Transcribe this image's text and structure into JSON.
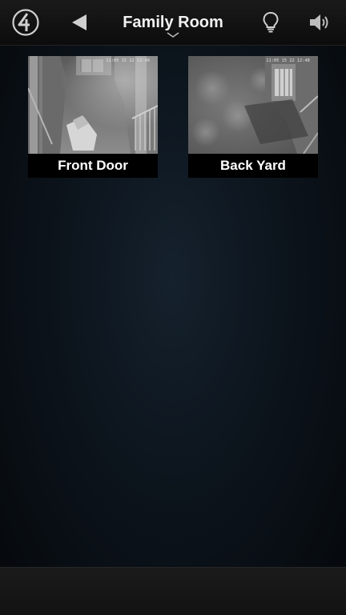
{
  "header": {
    "title": "Family Room"
  },
  "icons": {
    "logo": "control4-logo-icon",
    "back": "back-arrow-icon",
    "dropdown": "chevron-down-icon",
    "lights": "light-bulb-icon",
    "audio": "speaker-icon"
  },
  "cameras": [
    {
      "label": "Front Door",
      "timestamp": "11:05 15 22 12:48"
    },
    {
      "label": "Back Yard",
      "timestamp": "11:05 15 22 12:48"
    }
  ],
  "colors": {
    "background": "#0c141c",
    "bar": "#141414",
    "text": "#ffffff"
  }
}
